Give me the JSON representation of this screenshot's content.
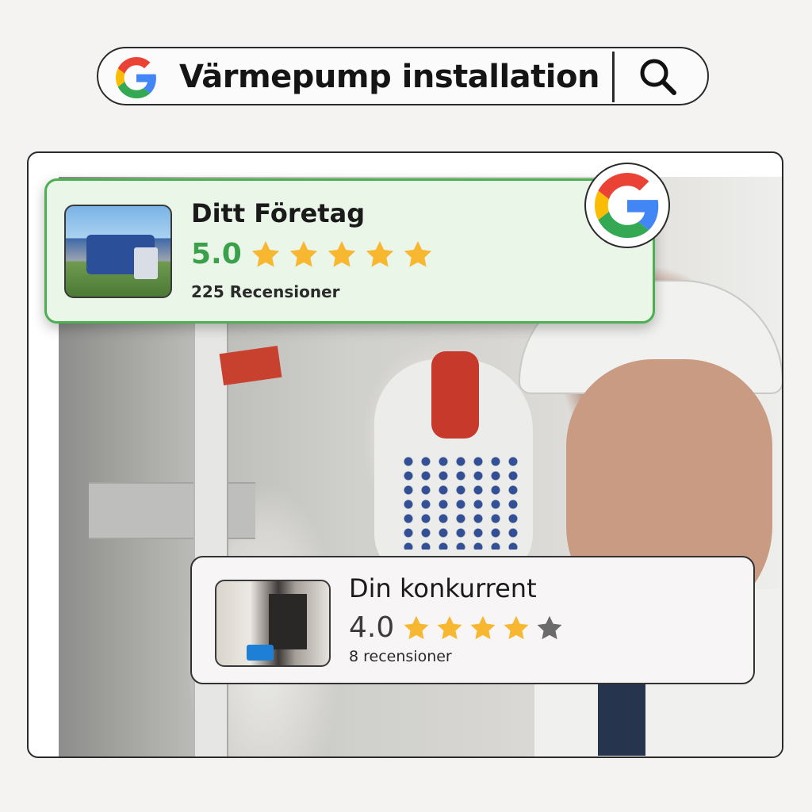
{
  "search": {
    "query": "Värmepump installation",
    "logo_icon": "google-g-icon",
    "button_icon": "search-icon"
  },
  "photo": {
    "subject": "installer-photo"
  },
  "listings": [
    {
      "name": "Ditt Företag",
      "rating": "5.0",
      "stars_filled": 5,
      "stars_total": 5,
      "reviews": "225 Recensioner",
      "accent": "#4caf50"
    },
    {
      "name": "Din konkurrent",
      "rating": "4.0",
      "stars_filled": 4,
      "stars_total": 5,
      "reviews": "8 recensioner",
      "accent": "#333333"
    }
  ],
  "colors": {
    "star_filled": "#f7b731",
    "star_empty": "#6b6b6b",
    "google_blue": "#4285F4",
    "google_red": "#EA4335",
    "google_yellow": "#FBBC05",
    "google_green": "#34A853"
  }
}
